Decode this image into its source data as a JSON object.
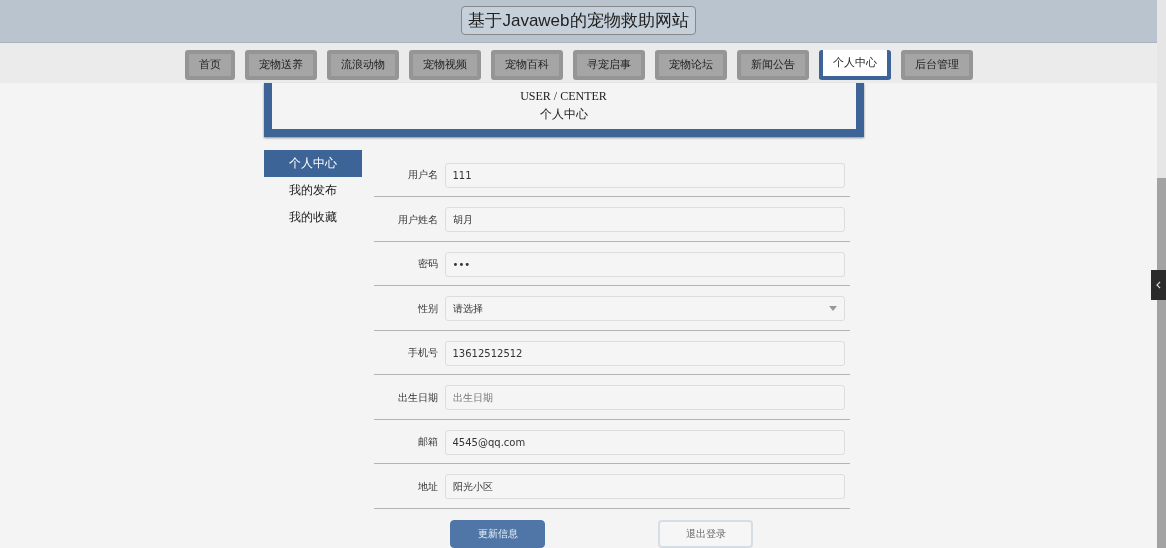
{
  "header": {
    "title": "基于Javaweb的宠物救助网站"
  },
  "nav": [
    {
      "label": "首页",
      "selected": false
    },
    {
      "label": "宠物送养",
      "selected": false
    },
    {
      "label": "流浪动物",
      "selected": false
    },
    {
      "label": "宠物视频",
      "selected": false
    },
    {
      "label": "宠物百科",
      "selected": false
    },
    {
      "label": "寻宠启事",
      "selected": false
    },
    {
      "label": "宠物论坛",
      "selected": false
    },
    {
      "label": "新闻公告",
      "selected": false
    },
    {
      "label": "个人中心",
      "selected": true
    },
    {
      "label": "后台管理",
      "selected": false
    }
  ],
  "banner": {
    "title_en": "USER / CENTER",
    "title": "个人中心"
  },
  "sidebar": {
    "items": [
      {
        "label": "个人中心",
        "selected": true
      },
      {
        "label": "我的发布",
        "selected": false
      },
      {
        "label": "我的收藏",
        "selected": false
      }
    ]
  },
  "form": {
    "fields": [
      {
        "kind": "text",
        "label": "用户名",
        "value": "111"
      },
      {
        "kind": "text",
        "label": "用户姓名",
        "value": "胡月"
      },
      {
        "kind": "password",
        "label": "密码",
        "value": "•••"
      },
      {
        "kind": "select",
        "label": "性别",
        "value": "请选择"
      },
      {
        "kind": "text",
        "label": "手机号",
        "value": "13612512512"
      },
      {
        "kind": "text",
        "label": "出生日期",
        "placeholder": "出生日期"
      },
      {
        "kind": "text",
        "label": "邮箱",
        "value": "4545@qq.com"
      },
      {
        "kind": "text",
        "label": "地址",
        "value": "阳光小区"
      }
    ],
    "buttons": [
      {
        "label": "更新信息",
        "kind": "primary"
      },
      {
        "label": "退出登录",
        "kind": "secondary"
      }
    ]
  }
}
